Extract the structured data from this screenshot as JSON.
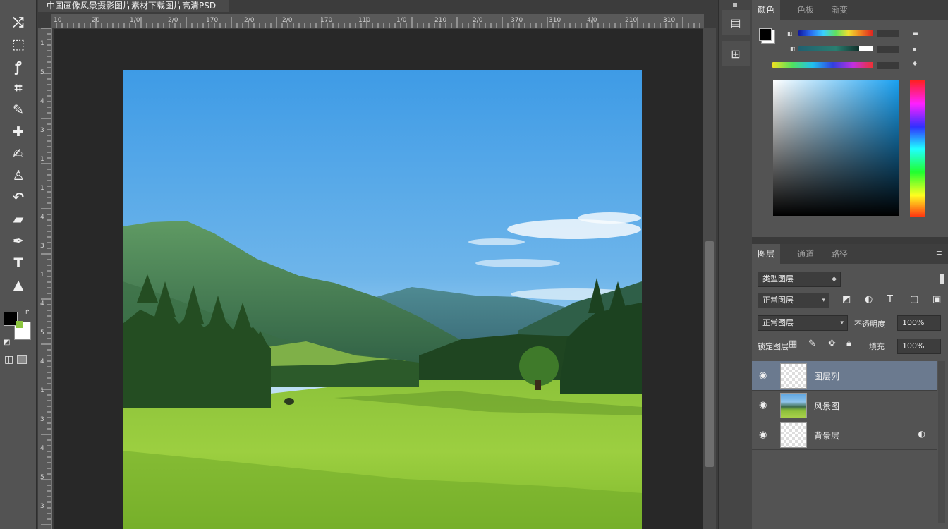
{
  "document": {
    "tab_title": "中国画像风景摄影图片素材下载图片高清PSD"
  },
  "toolbar": {
    "tools": [
      {
        "name": "move-tool-icon",
        "glyph": "⤭"
      },
      {
        "name": "marquee-tool-icon",
        "glyph": "⬚"
      },
      {
        "name": "lasso-tool-icon",
        "glyph": "ꝭ"
      },
      {
        "name": "crop-tool-icon",
        "glyph": "⌗"
      },
      {
        "name": "eyedropper-tool-icon",
        "glyph": "✎"
      },
      {
        "name": "healing-brush-icon",
        "glyph": "✚"
      },
      {
        "name": "brush-tool-icon",
        "glyph": "✍"
      },
      {
        "name": "clone-stamp-icon",
        "glyph": "♙"
      },
      {
        "name": "history-brush-icon",
        "glyph": "↶"
      },
      {
        "name": "eraser-tool-icon",
        "glyph": "▰"
      },
      {
        "name": "pen-tool-icon",
        "glyph": "✒"
      },
      {
        "name": "text-tool-icon",
        "glyph": "T"
      },
      {
        "name": "shape-tool-icon",
        "glyph": "▲"
      },
      {
        "name": "hand-tool-icon",
        "glyph": "☚"
      }
    ],
    "foreground_color": "#000000",
    "background_color": "#ffffff"
  },
  "ruler": {
    "top_labels": [
      "10",
      "20",
      "1/0",
      "2/0",
      "170",
      "2/0",
      "2/0",
      "170",
      "110",
      "1/0",
      "210",
      "2/0",
      "370",
      "310",
      "4/0",
      "210",
      "310"
    ],
    "left_labels": [
      "1",
      "5",
      "4",
      "3",
      "1",
      "1",
      "4",
      "3",
      "1",
      "4",
      "5",
      "4",
      "1",
      "3",
      "4",
      "5",
      "3"
    ]
  },
  "dock": {
    "buttons": [
      {
        "name": "history-panel-icon",
        "glyph": "▤"
      },
      {
        "name": "properties-panel-icon",
        "glyph": "⊞"
      }
    ]
  },
  "color_panel": {
    "tabs": [
      "颜色",
      "色板",
      "渐变"
    ],
    "active_tab": 0,
    "sliders": {
      "slider_1": "hue-gradient",
      "slider_2": "saturation-gradient",
      "slider_3": "spectrum-gradient"
    }
  },
  "layers_panel": {
    "tabs": [
      "图层",
      "通道",
      "路径"
    ],
    "active_tab": 0,
    "kind_filter": "类型图层",
    "blend_mode": "正常图层",
    "opacity_label": "不透明度",
    "opacity_value": "100%",
    "lock_label": "锁定图层",
    "fill_label": "填充",
    "fill_value": "100%",
    "layers": [
      {
        "name": "图层列",
        "thumb": "transparent",
        "selected": true,
        "extra": ""
      },
      {
        "name": "风景图",
        "thumb": "photo",
        "selected": false,
        "extra": ""
      },
      {
        "name": "背景层",
        "thumb": "transparent",
        "selected": false,
        "extra": "◐"
      }
    ]
  }
}
